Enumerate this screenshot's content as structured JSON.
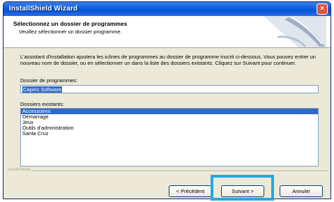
{
  "window": {
    "title": "InstallShield Wizard",
    "close_icon": "×"
  },
  "header": {
    "title": "Sélectionnez un dossier de programmes",
    "subtitle": "Veuillez sélectionner un dossier programme."
  },
  "body": {
    "description": "L'assistant d'installation ajoutera les icônes de programmes au dossier de programme inscrit ci-dessous. Vous pouvez entrer un nouveau nom de dossier, ou en sélectionner un dans la liste des dossiers existants. Cliquez sur Suivant pour continuer.",
    "program_folder_label": "Dossier de programmes:",
    "program_folder_value": "Capiris Software",
    "existing_folders_label": "Dossiers existants:",
    "existing_folders": [
      {
        "label": "Accessoires",
        "selected": true
      },
      {
        "label": "Démarrage",
        "selected": false
      },
      {
        "label": "Jeux",
        "selected": false
      },
      {
        "label": "Outils d'administration",
        "selected": false
      },
      {
        "label": "Santa Cruz",
        "selected": false
      }
    ]
  },
  "footer": {
    "brand": "InstallShield",
    "back_label": "< Précédent",
    "next_label": "Suivant >",
    "cancel_label": "Annuler"
  },
  "colors": {
    "titlebar": "#0553d6",
    "selection": "#316ac5",
    "highlight": "#22a9e0"
  }
}
